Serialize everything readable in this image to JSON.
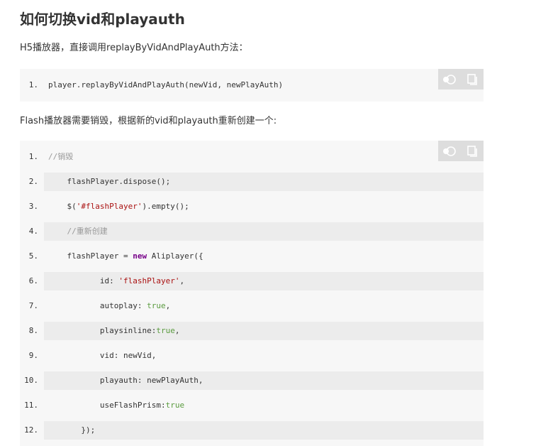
{
  "heading": "如何切换vid和playauth",
  "intro_h5": "H5播放器，直接调用replayByVidAndPlayAuth方法：",
  "intro_flash": "Flash播放器需要销毁，根据新的vid和playauth重新创建一个:",
  "toolbar": {
    "toggle_icon": "toggle-theme-icon",
    "copy_icon": "copy-icon"
  },
  "block1": {
    "lines": [
      {
        "num": "1.",
        "code": "player.replayByVidAndPlayAuth(newVid, newPlayAuth)"
      }
    ]
  },
  "block2": {
    "lines": [
      {
        "num": "1.",
        "parts": [
          {
            "cls": "cm",
            "t": "//销毁"
          }
        ]
      },
      {
        "num": "2.",
        "parts": [
          {
            "cls": "",
            "t": "    flashPlayer.dispose();"
          }
        ]
      },
      {
        "num": "3.",
        "parts": [
          {
            "cls": "",
            "t": "    $("
          },
          {
            "cls": "str",
            "t": "'#flashPlayer'"
          },
          {
            "cls": "",
            "t": ").empty();"
          }
        ]
      },
      {
        "num": "4.",
        "parts": [
          {
            "cls": "cm",
            "t": "    //重新创建"
          }
        ]
      },
      {
        "num": "5.",
        "parts": [
          {
            "cls": "",
            "t": "    flashPlayer = "
          },
          {
            "cls": "kw",
            "t": "new"
          },
          {
            "cls": "",
            "t": " Aliplayer({"
          }
        ]
      },
      {
        "num": "6.",
        "parts": [
          {
            "cls": "",
            "t": "           id: "
          },
          {
            "cls": "str",
            "t": "'flashPlayer'"
          },
          {
            "cls": "",
            "t": ","
          }
        ]
      },
      {
        "num": "7.",
        "parts": [
          {
            "cls": "",
            "t": "           autoplay: "
          },
          {
            "cls": "bool",
            "t": "true"
          },
          {
            "cls": "",
            "t": ","
          }
        ]
      },
      {
        "num": "8.",
        "parts": [
          {
            "cls": "",
            "t": "           playsinline:"
          },
          {
            "cls": "bool",
            "t": "true"
          },
          {
            "cls": "",
            "t": ","
          }
        ]
      },
      {
        "num": "9.",
        "parts": [
          {
            "cls": "",
            "t": "           vid: newVid,"
          }
        ]
      },
      {
        "num": "10.",
        "parts": [
          {
            "cls": "",
            "t": "           playauth: newPlayAuth,"
          }
        ]
      },
      {
        "num": "11.",
        "parts": [
          {
            "cls": "",
            "t": "           useFlashPrism:"
          },
          {
            "cls": "bool",
            "t": "true"
          }
        ]
      },
      {
        "num": "12.",
        "parts": [
          {
            "cls": "",
            "t": "       });"
          }
        ]
      }
    ]
  },
  "colors": {
    "code_bg": "#f7f7f7",
    "stripe": "#ececec",
    "toolbar_bg": "#dddddd",
    "string": "#aa1111",
    "keyword": "#770088",
    "boolean": "#5a9b3f",
    "comment": "#999999"
  }
}
